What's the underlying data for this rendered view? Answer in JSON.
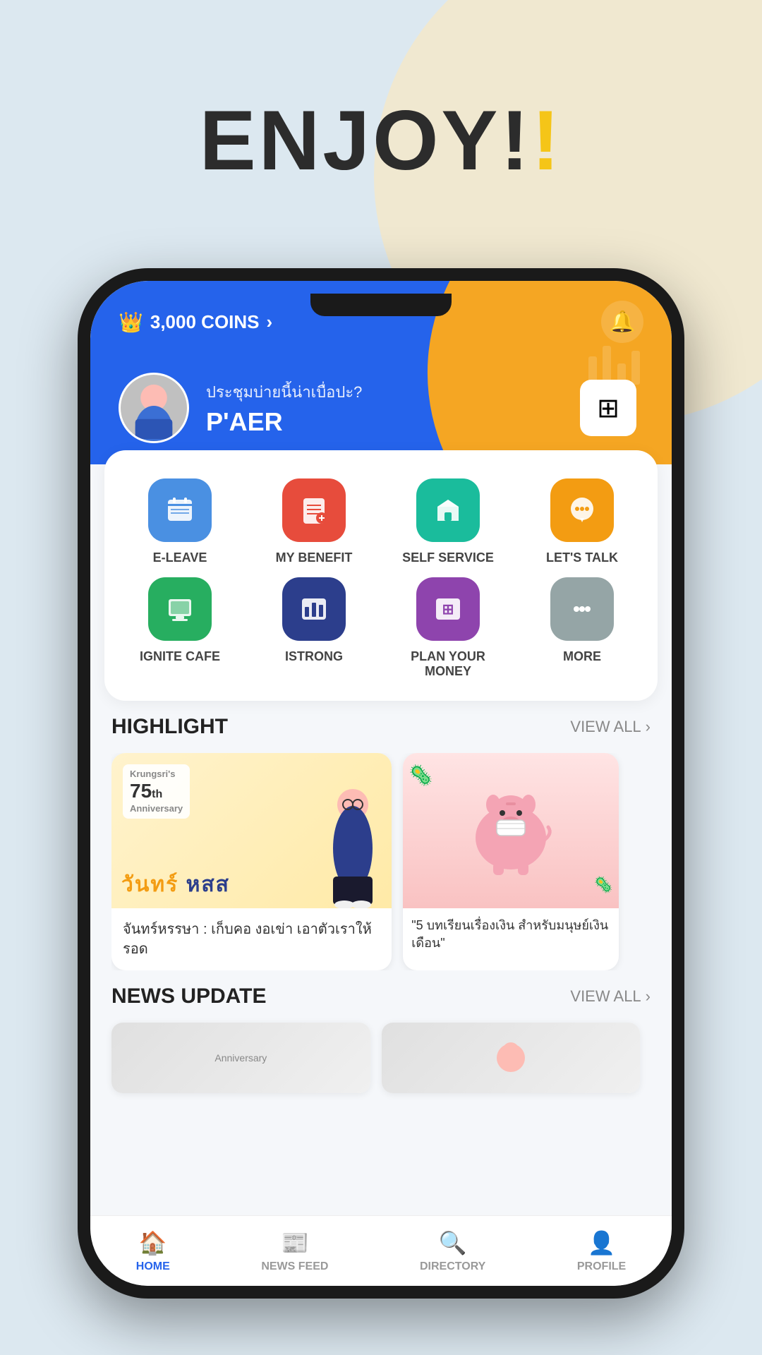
{
  "page": {
    "title": "ENJOY!"
  },
  "header": {
    "coins": "3,000 COINS",
    "greeting": "ประชุมบ่ายนี้น่าเบื่อปะ?",
    "user_name": "P'AER"
  },
  "menu": {
    "items": [
      {
        "id": "e-leave",
        "label": "E-LEAVE",
        "icon": "📅",
        "color_class": "icon-blue"
      },
      {
        "id": "my-benefit",
        "label": "MY BENEFIT",
        "icon": "📋",
        "color_class": "icon-red"
      },
      {
        "id": "self-service",
        "label": "SELF SERVICE",
        "icon": "🏠",
        "color_class": "icon-teal"
      },
      {
        "id": "lets-talk",
        "label": "LET'S TALK",
        "icon": "💬",
        "color_class": "icon-yellow"
      },
      {
        "id": "ignite-cafe",
        "label": "IGNITE CAFE",
        "icon": "🖥",
        "color_class": "icon-green"
      },
      {
        "id": "istrong",
        "label": "ISTRONG",
        "icon": "📊",
        "color_class": "icon-darkblue"
      },
      {
        "id": "plan-money",
        "label": "PLAN YOUR MONEY",
        "icon": "🔢",
        "color_class": "icon-purple"
      },
      {
        "id": "more",
        "label": "MORE",
        "icon": "···",
        "color_class": "icon-gray"
      }
    ]
  },
  "highlight": {
    "section_title": "HIGHLIGHT",
    "view_all": "VIEW ALL",
    "cards": [
      {
        "id": "card1",
        "anniversary": "Krungsri's 75th Anniversary",
        "thai_text": "วันทร์ หสส",
        "description": "จันทร์หรรษา : เก็บคอ งอเข่า เอาตัวเราให้รอด"
      },
      {
        "id": "card2",
        "description": "\"5 บทเรียนเรื่องเงิน สำหรับมนุษย์เงินเดือน\""
      }
    ]
  },
  "news_update": {
    "section_title": "NEWS UPDATE",
    "view_all": "VIEW ALL",
    "badge": "Anniversary"
  },
  "bottom_nav": {
    "items": [
      {
        "id": "home",
        "label": "HOME",
        "icon": "🏠",
        "active": true
      },
      {
        "id": "news-feed",
        "label": "NEWS FEED",
        "icon": "📰",
        "active": false
      },
      {
        "id": "directory",
        "label": "DIRECTORY",
        "icon": "🔍",
        "active": false
      },
      {
        "id": "profile",
        "label": "PROFILE",
        "icon": "👤",
        "active": false
      }
    ]
  }
}
